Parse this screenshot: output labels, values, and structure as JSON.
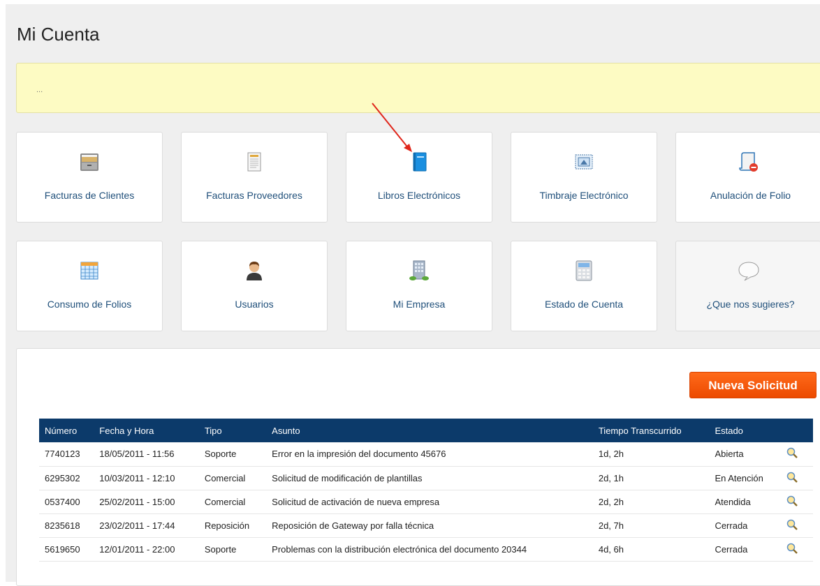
{
  "page": {
    "title": "Mi Cuenta",
    "notice": "..."
  },
  "tiles": [
    {
      "label": "Facturas de Clientes",
      "icon": "file-cabinet-icon"
    },
    {
      "label": "Facturas Proveedores",
      "icon": "document-icon"
    },
    {
      "label": "Libros Electrónicos",
      "icon": "book-icon"
    },
    {
      "label": "Timbraje Electrónico",
      "icon": "stamp-icon"
    },
    {
      "label": "Anulación de Folio",
      "icon": "scroll-cancel-icon"
    },
    {
      "label": "Consumo de Folios",
      "icon": "calendar-icon"
    },
    {
      "label": "Usuarios",
      "icon": "user-icon"
    },
    {
      "label": "Mi Empresa",
      "icon": "building-icon"
    },
    {
      "label": "Estado de Cuenta",
      "icon": "calculator-icon"
    },
    {
      "label": "¿Que nos sugieres?",
      "icon": "speech-bubble-icon"
    }
  ],
  "requests": {
    "new_button": "Nueva Solicitud",
    "headers": [
      "Número",
      "Fecha y Hora",
      "Tipo",
      "Asunto",
      "Tiempo Transcurrido",
      "Estado"
    ],
    "rows": [
      [
        "7740123",
        "18/05/2011 - 11:56",
        "Soporte",
        "Error en la impresión del documento 45676",
        "1d, 2h",
        "Abierta"
      ],
      [
        "6295302",
        "10/03/2011 - 12:10",
        "Comercial",
        "Solicitud de modificación de plantillas",
        "2d, 1h",
        "En Atención"
      ],
      [
        "0537400",
        "25/02/2011 - 15:00",
        "Comercial",
        "Solicitud de activación de nueva empresa",
        "2d, 2h",
        "Atendida"
      ],
      [
        "8235618",
        "23/02/2011 - 17:44",
        "Reposición",
        "Reposición de Gateway por falla técnica",
        "2d, 7h",
        "Cerrada"
      ],
      [
        "5619650",
        "12/01/2011 - 22:00",
        "Soporte",
        "Problemas con la distribución electrónica del documento 20344",
        "4d, 6h",
        "Cerrada"
      ]
    ]
  },
  "colors": {
    "accent": "#ec4a00",
    "header": "#0c3a6a",
    "link": "#1f4f7a",
    "notice": "#fdfbc3"
  }
}
